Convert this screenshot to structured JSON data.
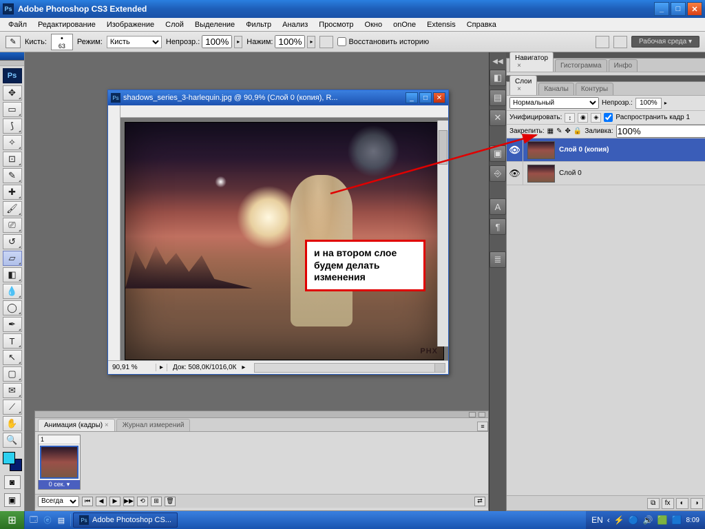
{
  "app": {
    "title": "Adobe Photoshop CS3 Extended",
    "ps_badge": "Ps"
  },
  "menu": [
    "Файл",
    "Редактирование",
    "Изображение",
    "Слой",
    "Выделение",
    "Фильтр",
    "Анализ",
    "Просмотр",
    "Окно",
    "onOne",
    "Extensis",
    "Справка"
  ],
  "options": {
    "brush_label": "Кисть:",
    "brush_size": "63",
    "mode_label": "Режим:",
    "mode_value": "Кисть",
    "opacity_label": "Непрозр.:",
    "opacity_value": "100%",
    "flow_label": "Нажим:",
    "flow_value": "100%",
    "restore_label": "Восстановить историю",
    "workspace_label": "Рабочая среда"
  },
  "document": {
    "title": "shadows_series_3-harlequin.jpg @ 90,9% (Слой 0 (копия), R...",
    "zoom": "90,91 %",
    "docsize": "Док: 508,0К/1016,0К",
    "watermark": "PHX"
  },
  "annotation": {
    "text": "и на втором слое будем делать изменения"
  },
  "nav_panel_tabs": [
    "Навигатор",
    "Гистограмма",
    "Инфо"
  ],
  "layers_panel": {
    "tabs": [
      "Слои",
      "Каналы",
      "Контуры"
    ],
    "blend_label": "Нормальный",
    "opacity_label": "Непрозр.:",
    "opacity_value": "100%",
    "unify_label": "Унифицировать:",
    "propagate_label": "Распространить кадр 1",
    "lock_label": "Закрепить:",
    "fill_label": "Заливка:",
    "fill_value": "100%",
    "layers": [
      {
        "name": "Слой 0 (копия)",
        "selected": true
      },
      {
        "name": "Слой 0",
        "selected": false
      }
    ]
  },
  "animation_panel": {
    "tabs": [
      "Анимация (кадры)",
      "Журнал измерений"
    ],
    "frame_num": "1",
    "frame_dur": "0 сек.",
    "loop": "Всегда"
  },
  "taskbar": {
    "task": "Adobe Photoshop CS...",
    "lang": "EN",
    "time": "8:09"
  }
}
